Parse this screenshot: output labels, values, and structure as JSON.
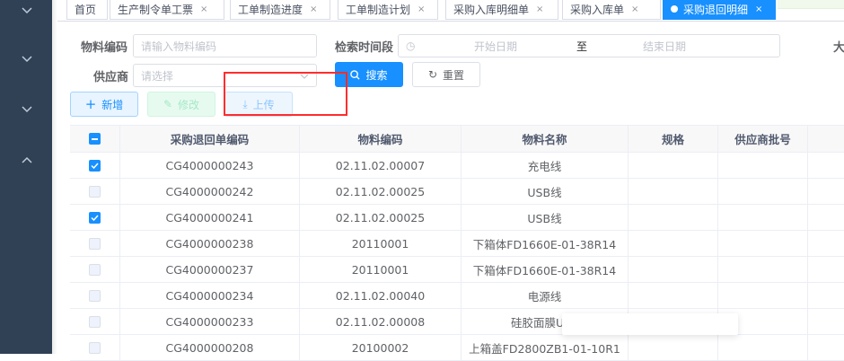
{
  "tabs": [
    {
      "label": "首页",
      "closable": false
    },
    {
      "label": "生产制令单工票",
      "closable": true
    },
    {
      "label": "工单制造进度",
      "closable": true
    },
    {
      "label": "工单制造计划",
      "closable": true
    },
    {
      "label": "采购入库明细单",
      "closable": true
    },
    {
      "label": "采购入库单",
      "closable": true
    },
    {
      "label": "采购退回明细",
      "closable": true,
      "active": true
    }
  ],
  "filters": {
    "material_code_label": "物料编码",
    "material_code_placeholder": "请输入物料编码",
    "date_range_label": "检索时间段",
    "start_placeholder": "开始日期",
    "range_sep": "至",
    "end_placeholder": "结束日期",
    "extra_label": "大",
    "supplier_label": "供应商",
    "supplier_placeholder": "请选择"
  },
  "actions": {
    "search": "搜索",
    "reset": "重置",
    "add": "新增",
    "edit": "修改",
    "upload": "上传"
  },
  "table": {
    "columns": [
      "采购退回单编码",
      "物料编码",
      "物料名称",
      "规格",
      "供应商批号"
    ],
    "rows": [
      {
        "checked": true,
        "code": "CG4000000243",
        "material": "02.11.02.00007",
        "name": "充电线",
        "spec": "",
        "batch": ""
      },
      {
        "checked": false,
        "code": "CG4000000242",
        "material": "02.11.02.00025",
        "name": "USB线",
        "spec": "",
        "batch": ""
      },
      {
        "checked": true,
        "code": "CG4000000241",
        "material": "02.11.02.00025",
        "name": "USB线",
        "spec": "",
        "batch": ""
      },
      {
        "checked": false,
        "code": "CG4000000238",
        "material": "20110001",
        "name": "下箱体FD1660E-01-38R14",
        "spec": "",
        "batch": ""
      },
      {
        "checked": false,
        "code": "CG4000000237",
        "material": "20110001",
        "name": "下箱体FD1660E-01-38R14",
        "spec": "",
        "batch": ""
      },
      {
        "checked": false,
        "code": "CG4000000234",
        "material": "02.11.02.00040",
        "name": "电源线",
        "spec": "",
        "batch": ""
      },
      {
        "checked": false,
        "code": "CG4000000233",
        "material": "02.11.02.00008",
        "name": "硅胶面膜USE",
        "spec": "",
        "batch": ""
      },
      {
        "checked": false,
        "code": "CG4000000208",
        "material": "20100002",
        "name": "上箱盖FD2800ZB1-01-10R1",
        "spec": "",
        "batch": ""
      }
    ]
  },
  "colors": {
    "sidebar": "#304156",
    "primary": "#1890ff",
    "highlight": "#ff2d2d"
  }
}
